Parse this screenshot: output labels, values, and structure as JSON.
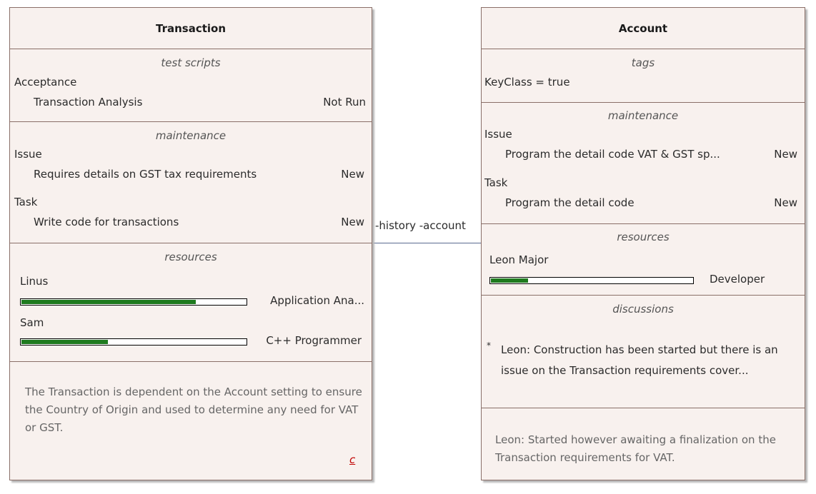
{
  "connector": {
    "label": "-history -account"
  },
  "transaction": {
    "title": "Transaction",
    "test_scripts": {
      "title": "test scripts",
      "category": "Acceptance",
      "item_name": "Transaction Analysis",
      "item_status": "Not Run"
    },
    "maintenance": {
      "title": "maintenance",
      "issue_label": "Issue",
      "issue_item": "Requires details on GST tax requirements",
      "issue_status": "New",
      "task_label": "Task",
      "task_item": "Write code for transactions",
      "task_status": "New"
    },
    "resources": {
      "title": "resources",
      "items": [
        {
          "name": "Linus",
          "role": "Application Ana...",
          "progress": 0.78
        },
        {
          "name": "Sam",
          "role": "C++ Programmer",
          "progress": 0.39
        }
      ]
    },
    "notes": "The Transaction is dependent on the Account setting to ensure the Country of Origin and used to determine any need for VAT or GST.",
    "link_glyph": "c"
  },
  "account": {
    "title": "Account",
    "tags": {
      "title": "tags",
      "value": "KeyClass = true"
    },
    "maintenance": {
      "title": "maintenance",
      "issue_label": "Issue",
      "issue_item": "Program the detail code VAT & GST sp...",
      "issue_status": "New",
      "task_label": "Task",
      "task_item": "Program the detail code",
      "task_status": "New"
    },
    "resources": {
      "title": "resources",
      "items": [
        {
          "name": "Leon Major",
          "role": "Developer",
          "progress": 0.19
        }
      ]
    },
    "discussions": {
      "title": "discussions",
      "bullet": "*",
      "text_line1": "Leon: Construction has been started but there is an",
      "text_line2": "issue on the Transaction requirements cover..."
    },
    "notes": "Leon: Started however awaiting a finalization on the Transaction requirements for VAT."
  }
}
